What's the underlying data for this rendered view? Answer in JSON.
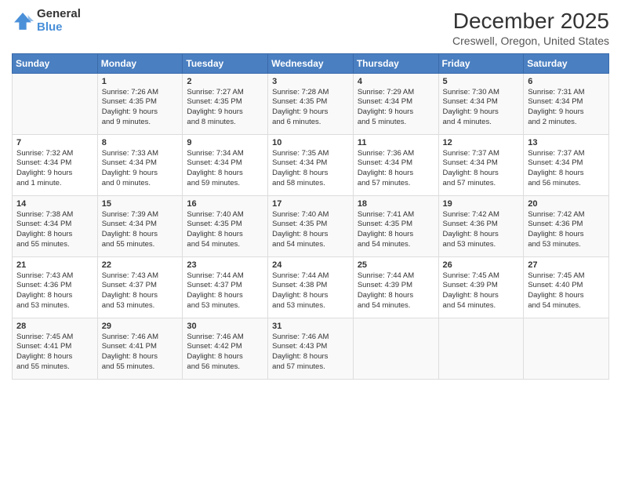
{
  "logo": {
    "general": "General",
    "blue": "Blue"
  },
  "title": "December 2025",
  "subtitle": "Creswell, Oregon, United States",
  "days_header": [
    "Sunday",
    "Monday",
    "Tuesday",
    "Wednesday",
    "Thursday",
    "Friday",
    "Saturday"
  ],
  "weeks": [
    [
      {
        "num": "",
        "info": ""
      },
      {
        "num": "1",
        "info": "Sunrise: 7:26 AM\nSunset: 4:35 PM\nDaylight: 9 hours\nand 9 minutes."
      },
      {
        "num": "2",
        "info": "Sunrise: 7:27 AM\nSunset: 4:35 PM\nDaylight: 9 hours\nand 8 minutes."
      },
      {
        "num": "3",
        "info": "Sunrise: 7:28 AM\nSunset: 4:35 PM\nDaylight: 9 hours\nand 6 minutes."
      },
      {
        "num": "4",
        "info": "Sunrise: 7:29 AM\nSunset: 4:34 PM\nDaylight: 9 hours\nand 5 minutes."
      },
      {
        "num": "5",
        "info": "Sunrise: 7:30 AM\nSunset: 4:34 PM\nDaylight: 9 hours\nand 4 minutes."
      },
      {
        "num": "6",
        "info": "Sunrise: 7:31 AM\nSunset: 4:34 PM\nDaylight: 9 hours\nand 2 minutes."
      }
    ],
    [
      {
        "num": "7",
        "info": "Sunrise: 7:32 AM\nSunset: 4:34 PM\nDaylight: 9 hours\nand 1 minute."
      },
      {
        "num": "8",
        "info": "Sunrise: 7:33 AM\nSunset: 4:34 PM\nDaylight: 9 hours\nand 0 minutes."
      },
      {
        "num": "9",
        "info": "Sunrise: 7:34 AM\nSunset: 4:34 PM\nDaylight: 8 hours\nand 59 minutes."
      },
      {
        "num": "10",
        "info": "Sunrise: 7:35 AM\nSunset: 4:34 PM\nDaylight: 8 hours\nand 58 minutes."
      },
      {
        "num": "11",
        "info": "Sunrise: 7:36 AM\nSunset: 4:34 PM\nDaylight: 8 hours\nand 57 minutes."
      },
      {
        "num": "12",
        "info": "Sunrise: 7:37 AM\nSunset: 4:34 PM\nDaylight: 8 hours\nand 57 minutes."
      },
      {
        "num": "13",
        "info": "Sunrise: 7:37 AM\nSunset: 4:34 PM\nDaylight: 8 hours\nand 56 minutes."
      }
    ],
    [
      {
        "num": "14",
        "info": "Sunrise: 7:38 AM\nSunset: 4:34 PM\nDaylight: 8 hours\nand 55 minutes."
      },
      {
        "num": "15",
        "info": "Sunrise: 7:39 AM\nSunset: 4:34 PM\nDaylight: 8 hours\nand 55 minutes."
      },
      {
        "num": "16",
        "info": "Sunrise: 7:40 AM\nSunset: 4:35 PM\nDaylight: 8 hours\nand 54 minutes."
      },
      {
        "num": "17",
        "info": "Sunrise: 7:40 AM\nSunset: 4:35 PM\nDaylight: 8 hours\nand 54 minutes."
      },
      {
        "num": "18",
        "info": "Sunrise: 7:41 AM\nSunset: 4:35 PM\nDaylight: 8 hours\nand 54 minutes."
      },
      {
        "num": "19",
        "info": "Sunrise: 7:42 AM\nSunset: 4:36 PM\nDaylight: 8 hours\nand 53 minutes."
      },
      {
        "num": "20",
        "info": "Sunrise: 7:42 AM\nSunset: 4:36 PM\nDaylight: 8 hours\nand 53 minutes."
      }
    ],
    [
      {
        "num": "21",
        "info": "Sunrise: 7:43 AM\nSunset: 4:36 PM\nDaylight: 8 hours\nand 53 minutes."
      },
      {
        "num": "22",
        "info": "Sunrise: 7:43 AM\nSunset: 4:37 PM\nDaylight: 8 hours\nand 53 minutes."
      },
      {
        "num": "23",
        "info": "Sunrise: 7:44 AM\nSunset: 4:37 PM\nDaylight: 8 hours\nand 53 minutes."
      },
      {
        "num": "24",
        "info": "Sunrise: 7:44 AM\nSunset: 4:38 PM\nDaylight: 8 hours\nand 53 minutes."
      },
      {
        "num": "25",
        "info": "Sunrise: 7:44 AM\nSunset: 4:39 PM\nDaylight: 8 hours\nand 54 minutes."
      },
      {
        "num": "26",
        "info": "Sunrise: 7:45 AM\nSunset: 4:39 PM\nDaylight: 8 hours\nand 54 minutes."
      },
      {
        "num": "27",
        "info": "Sunrise: 7:45 AM\nSunset: 4:40 PM\nDaylight: 8 hours\nand 54 minutes."
      }
    ],
    [
      {
        "num": "28",
        "info": "Sunrise: 7:45 AM\nSunset: 4:41 PM\nDaylight: 8 hours\nand 55 minutes."
      },
      {
        "num": "29",
        "info": "Sunrise: 7:46 AM\nSunset: 4:41 PM\nDaylight: 8 hours\nand 55 minutes."
      },
      {
        "num": "30",
        "info": "Sunrise: 7:46 AM\nSunset: 4:42 PM\nDaylight: 8 hours\nand 56 minutes."
      },
      {
        "num": "31",
        "info": "Sunrise: 7:46 AM\nSunset: 4:43 PM\nDaylight: 8 hours\nand 57 minutes."
      },
      {
        "num": "",
        "info": ""
      },
      {
        "num": "",
        "info": ""
      },
      {
        "num": "",
        "info": ""
      }
    ]
  ]
}
